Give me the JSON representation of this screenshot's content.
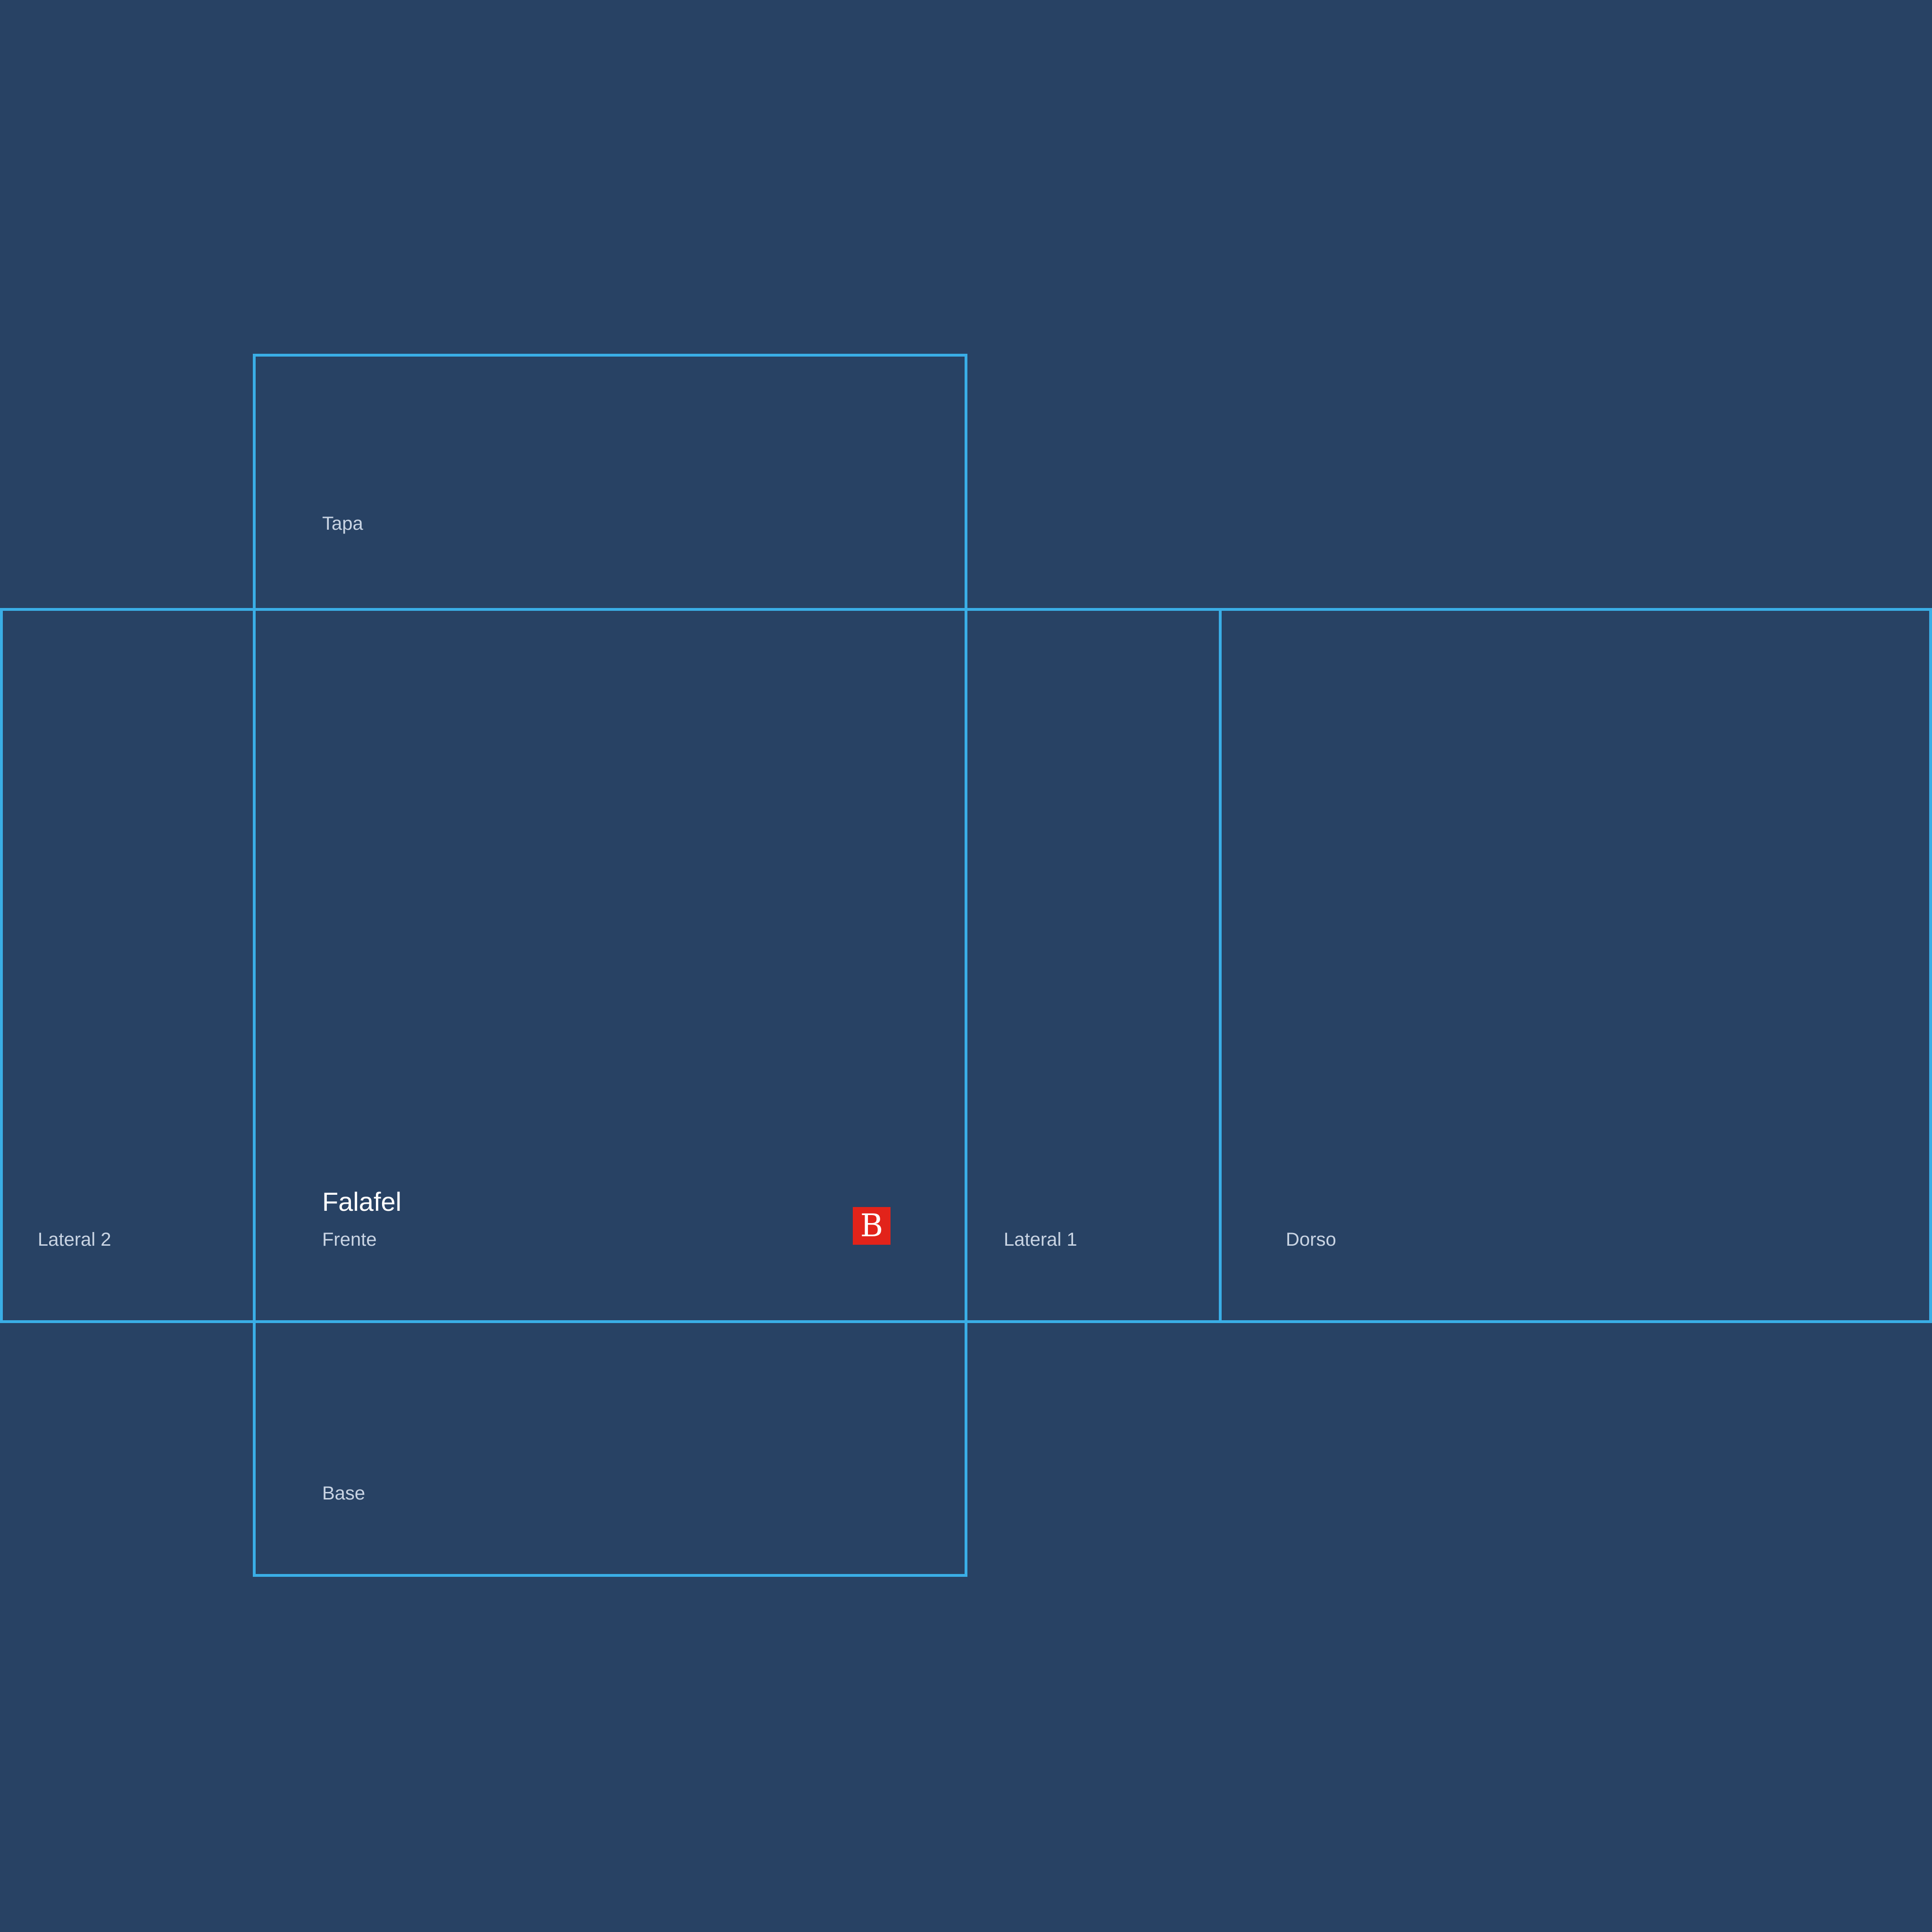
{
  "panels": {
    "tapa": "Tapa",
    "lateral2": "Lateral 2",
    "frente": "Frente",
    "lateral1": "Lateral 1",
    "dorso": "Dorso",
    "base": "Base"
  },
  "product": {
    "name": "Falafel"
  },
  "brand": {
    "logo_letter": "B",
    "logo_color": "#e2231a"
  },
  "colors": {
    "background": "#284264",
    "fold_line": "#3aaee6",
    "label_text": "#c9d4e3",
    "title_text": "#ffffff"
  }
}
